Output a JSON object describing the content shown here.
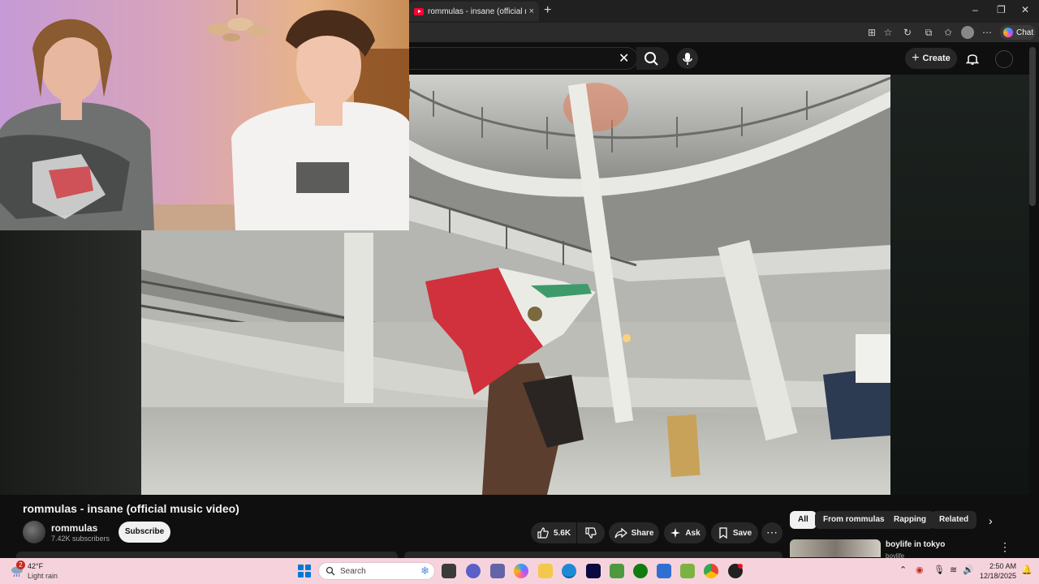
{
  "browser": {
    "tab_title": "rommulas - insane (official music vid",
    "tab_close": "×",
    "new_tab": "+",
    "window_minimize": "–",
    "window_restore": "❐",
    "window_close": "✕",
    "chat_label": "Chat"
  },
  "header": {
    "create_label": "Create"
  },
  "video": {
    "title": "rommulas - insane (official music video)",
    "channel": "rommulas",
    "subscribers": "7.42K subscribers",
    "subscribe_label": "Subscribe",
    "like_count": "5.6K",
    "share_label": "Share",
    "ask_label": "Ask",
    "save_label": "Save",
    "more_label": "⋯"
  },
  "chips": [
    "All",
    "From rommulas",
    "Rapping",
    "Related"
  ],
  "recommended": {
    "title": "boylife in tokyo",
    "channel": "boylife"
  },
  "taskbar": {
    "weather_badge": "2",
    "temperature": "42°F",
    "weather_desc": "Light rain",
    "search_placeholder": "Search",
    "time": "2:50 AM",
    "date": "12/18/2025"
  }
}
